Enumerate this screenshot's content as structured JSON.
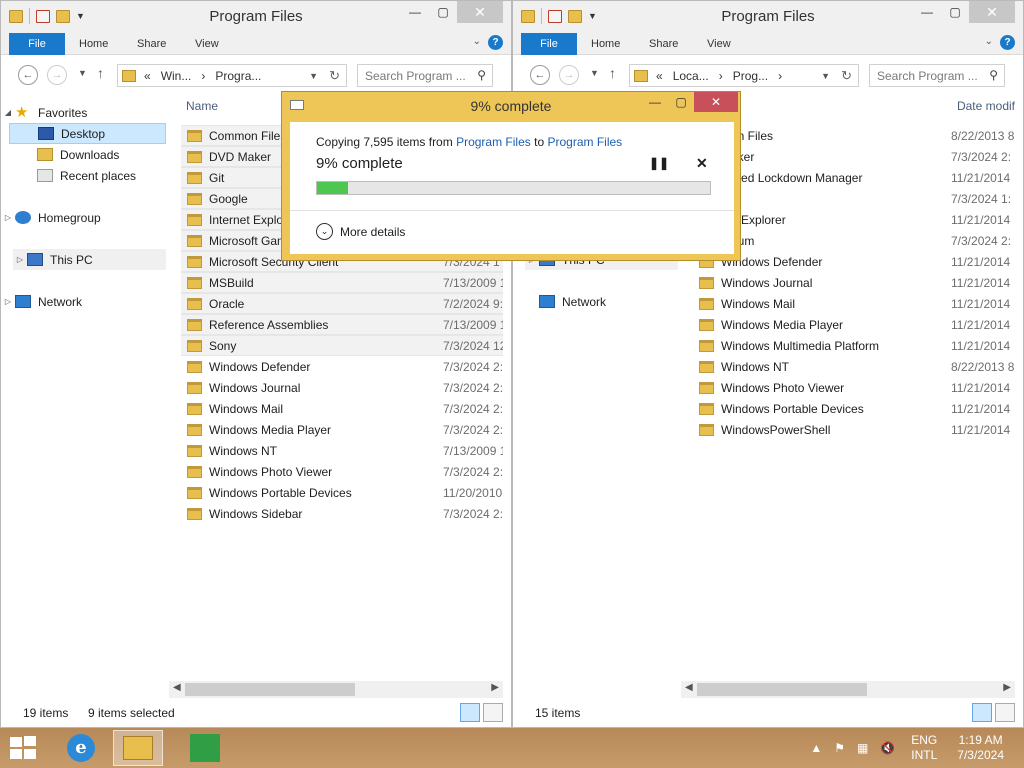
{
  "left": {
    "title": "Program Files",
    "ribbon": {
      "file": "File",
      "home": "Home",
      "share": "Share",
      "view": "View"
    },
    "address": [
      "«",
      "Win...",
      "›",
      "Progra..."
    ],
    "search_placeholder": "Search Program ...",
    "nav": {
      "favorites": "Favorites",
      "desktop": "Desktop",
      "downloads": "Downloads",
      "recent": "Recent places",
      "homegroup": "Homegroup",
      "this_pc": "This PC",
      "network": "Network"
    },
    "col_name": "Name",
    "rows": [
      {
        "name": "Common Files",
        "date": "",
        "selected": true
      },
      {
        "name": "DVD Maker",
        "date": "",
        "selected": true
      },
      {
        "name": "Git",
        "date": "",
        "selected": true
      },
      {
        "name": "Google",
        "date": "",
        "selected": true
      },
      {
        "name": "Internet Explorer",
        "date": "",
        "selected": true
      },
      {
        "name": "Microsoft Games",
        "date": "",
        "selected": true
      },
      {
        "name": "Microsoft Security Client",
        "date": "7/3/2024 1",
        "selected": true
      },
      {
        "name": "MSBuild",
        "date": "7/13/2009 1",
        "selected": true
      },
      {
        "name": "Oracle",
        "date": "7/2/2024 9:",
        "selected": true
      },
      {
        "name": "Reference Assemblies",
        "date": "7/13/2009 1",
        "selected": true
      },
      {
        "name": "Sony",
        "date": "7/3/2024 12",
        "selected": true
      },
      {
        "name": "Windows Defender",
        "date": "7/3/2024 2:",
        "selected": false
      },
      {
        "name": "Windows Journal",
        "date": "7/3/2024 2:",
        "selected": false
      },
      {
        "name": "Windows Mail",
        "date": "7/3/2024 2:",
        "selected": false
      },
      {
        "name": "Windows Media Player",
        "date": "7/3/2024 2:",
        "selected": false
      },
      {
        "name": "Windows NT",
        "date": "7/13/2009 1",
        "selected": false
      },
      {
        "name": "Windows Photo Viewer",
        "date": "7/3/2024 2:",
        "selected": false
      },
      {
        "name": "Windows Portable Devices",
        "date": "11/20/2010",
        "selected": false
      },
      {
        "name": "Windows Sidebar",
        "date": "7/3/2024 2:",
        "selected": false
      }
    ],
    "status_count": "19 items",
    "status_selected": "9 items selected"
  },
  "right": {
    "title": "Program Files",
    "ribbon": {
      "file": "File",
      "home": "Home",
      "share": "Share",
      "view": "View"
    },
    "address": [
      "«",
      "Loca...",
      "›",
      "Prog...",
      "›"
    ],
    "search_placeholder": "Search Program ...",
    "nav": {
      "this_pc": "This PC",
      "network": "Network"
    },
    "col_date": "Date modif",
    "rows": [
      {
        "name": "mon Files",
        "date": "8/22/2013 8"
      },
      {
        "name": "Maker",
        "date": "7/3/2024 2:"
      },
      {
        "name": "edded Lockdown Manager",
        "date": "11/21/2014"
      },
      {
        "name": "",
        "date": "7/3/2024 1:"
      },
      {
        "name": "net Explorer",
        "date": "11/21/2014"
      },
      {
        "name": "rmium",
        "date": "7/3/2024 2:"
      },
      {
        "name": "Windows Defender",
        "date": "11/21/2014"
      },
      {
        "name": "Windows Journal",
        "date": "11/21/2014"
      },
      {
        "name": "Windows Mail",
        "date": "11/21/2014"
      },
      {
        "name": "Windows Media Player",
        "date": "11/21/2014"
      },
      {
        "name": "Windows Multimedia Platform",
        "date": "11/21/2014"
      },
      {
        "name": "Windows NT",
        "date": "8/22/2013 8"
      },
      {
        "name": "Windows Photo Viewer",
        "date": "11/21/2014"
      },
      {
        "name": "Windows Portable Devices",
        "date": "11/21/2014"
      },
      {
        "name": "WindowsPowerShell",
        "date": "11/21/2014"
      }
    ],
    "status_count": "15 items"
  },
  "dialog": {
    "title": "9% complete",
    "copy_prefix": "Copying 7,595 items from",
    "copy_src": "Program Files",
    "copy_to": "to",
    "copy_dst": "Program Files",
    "percent_text": "9% complete",
    "progress": 0.08,
    "more_details": "More details"
  },
  "taskbar": {
    "lang_top": "ENG",
    "lang_bottom": "INTL",
    "time": "1:19 AM",
    "date": "7/3/2024"
  },
  "colors": {
    "accent": "#1979ca",
    "dialog_frame": "#edc657",
    "progress_fill": "#4ec750",
    "close_button": "#c7505a"
  }
}
